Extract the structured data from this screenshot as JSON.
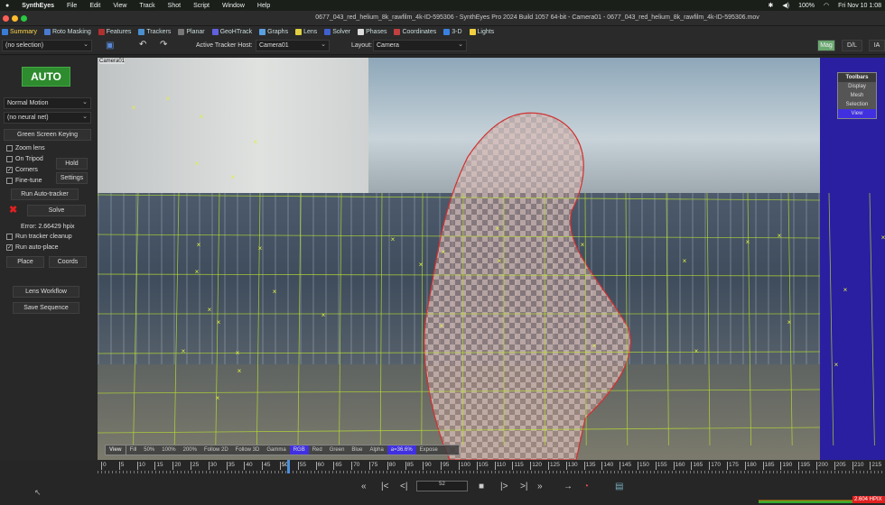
{
  "menubar": {
    "app": "SynthEyes",
    "items": [
      "File",
      "Edit",
      "View",
      "Track",
      "Shot",
      "Script",
      "Window",
      "Help"
    ],
    "battery": "100%",
    "clock": "Fri Nov 10  1:08"
  },
  "window": {
    "title": "0677_043_red_helium_8k_rawfilm_4k-ID-595306 - SynthEyes Pro 2024 Build 1057 64-bit - Camera01 - 0677_043_red_helium_8k_rawfilm_4k-ID-595306.mov"
  },
  "tabs": [
    {
      "label": "Summary",
      "color": "#3a7bd5"
    },
    {
      "label": "Roto Masking",
      "color": "#4a7ad0"
    },
    {
      "label": "Features",
      "color": "#b03030"
    },
    {
      "label": "Trackers",
      "color": "#4a90d0"
    },
    {
      "label": "Planar",
      "color": "#777777"
    },
    {
      "label": "GeoHTrack",
      "color": "#6060e0"
    },
    {
      "label": "Graphs",
      "color": "#5aa0e0"
    },
    {
      "label": "Lens",
      "color": "#e0d040"
    },
    {
      "label": "Solver",
      "color": "#4060d0"
    },
    {
      "label": "Phases",
      "color": "#dddddd"
    },
    {
      "label": "Coordinates",
      "color": "#c04040"
    },
    {
      "label": "3-D",
      "color": "#3a80e0"
    },
    {
      "label": "Lights",
      "color": "#f0d040"
    }
  ],
  "toolbar": {
    "selection": "(no selection)",
    "active_tracker_host_label": "Active Tracker Host:",
    "active_tracker_host": "Camera01",
    "layout_label": "Layout:",
    "layout": "Camera",
    "mode_buttons": [
      "Mag",
      "D/L",
      "IA"
    ]
  },
  "left": {
    "auto": "AUTO",
    "motion": "Normal Motion",
    "neural": "(no neural net)",
    "green_screen": "Green Screen Keying",
    "zoom_lens": "Zoom lens",
    "on_tripod": "On Tripod",
    "corners": "Corners",
    "fine_tune": "Fine-tune",
    "hold": "Hold",
    "settings": "Settings",
    "run_auto": "Run Auto-tracker",
    "solve": "Solve",
    "error": "Error: 2.66429 hpix",
    "cleanup": "Run tracker cleanup",
    "autoplace": "Run auto-place",
    "place": "Place",
    "coords": "Coords",
    "lens_workflow": "Lens Workflow",
    "save_sequence": "Save Sequence"
  },
  "viewport": {
    "camera_label": "Camera01",
    "toolbars": {
      "title": "Toolbars",
      "items": [
        "Display",
        "Mesh",
        "Selection",
        "View"
      ],
      "active": "View"
    },
    "viewbar": [
      "View",
      "Fill",
      "50%",
      "100%",
      "200%",
      "Follow 2D",
      "Follow 3D",
      "Gamma",
      "RGB",
      "Red",
      "Green",
      "Blue",
      "Alpha",
      "a=36.6%",
      "Expose"
    ],
    "viewbar_active": [
      "RGB",
      "a=36.6%"
    ]
  },
  "timeline": {
    "start": 0,
    "end": 215,
    "step": 5,
    "current": 52
  },
  "transport": {
    "frame": "52",
    "rate": "2.604 HPIX"
  },
  "colors": {
    "accent_green": "#2e8b2e",
    "roto": "#d03030",
    "grid": "#b8e030",
    "tracker": "#e0f040",
    "panel_blue": "#2a1fa0"
  }
}
